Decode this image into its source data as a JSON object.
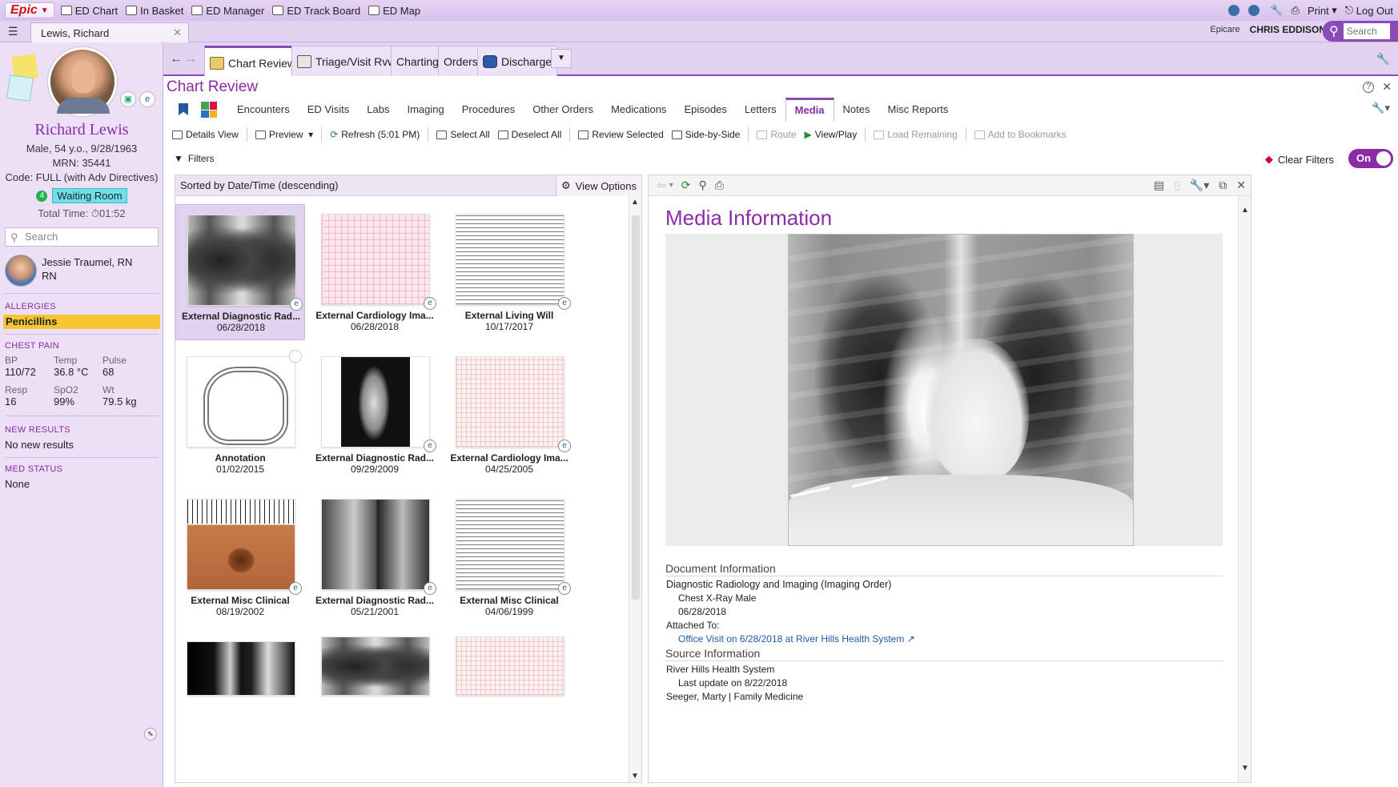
{
  "topbar": {
    "epic_label": "Epic",
    "nav": [
      "ED Chart",
      "In Basket",
      "ED Manager",
      "ED Track Board",
      "ED Map"
    ],
    "print_label": "Print",
    "logout_label": "Log Out"
  },
  "tabbar": {
    "patient_tab": "Lewis, Richard",
    "environment": "Epicare",
    "user": "CHRIS EDDISON",
    "search_placeholder": "Search"
  },
  "activity_tabs": [
    "Chart Review",
    "Triage/Visit Rvw",
    "Charting",
    "Orders",
    "Discharge"
  ],
  "patient": {
    "name": "Richard Lewis",
    "demo": "Male, 54 y.o., 9/28/1963",
    "mrn": "MRN: 35441",
    "code": "Code: FULL (with Adv Directives)",
    "room_num": "4",
    "room": "Waiting Room",
    "total_time": "Total Time: ⏱01:52",
    "search_placeholder": "Search",
    "nurse_name": "Jessie Traumel, RN",
    "nurse_role": "RN"
  },
  "sidebar": {
    "allergies_label": "ALLERGIES",
    "allergy": "Penicillins",
    "complaint_label": "CHEST PAIN",
    "vitals": [
      {
        "label": "BP",
        "value": "110/72"
      },
      {
        "label": "Temp",
        "value": "36.8 °C"
      },
      {
        "label": "Pulse",
        "value": "68"
      },
      {
        "label": "Resp",
        "value": "16"
      },
      {
        "label": "SpO2",
        "value": "99%"
      },
      {
        "label": "Wt",
        "value": "79.5 kg"
      }
    ],
    "results_label": "NEW RESULTS",
    "results_value": "No new results",
    "med_label": "MED STATUS",
    "med_value": "None"
  },
  "chart_review": {
    "title": "Chart Review",
    "subtabs": [
      "Encounters",
      "ED Visits",
      "Labs",
      "Imaging",
      "Procedures",
      "Other Orders",
      "Medications",
      "Episodes",
      "Letters",
      "Media",
      "Notes",
      "Misc Reports"
    ],
    "active_subtab": "Media",
    "toolbar": {
      "details_view": "Details View",
      "preview": "Preview",
      "refresh": "Refresh (5:01 PM)",
      "select_all": "Select All",
      "deselect_all": "Deselect All",
      "review_selected": "Review Selected",
      "side_by_side": "Side-by-Side",
      "route": "Route",
      "view_play": "View/Play",
      "load_remaining": "Load Remaining",
      "add_bookmarks": "Add to Bookmarks"
    },
    "filters_label": "Filters",
    "clear_filters": "Clear Filters",
    "toggle": "On",
    "sort_label": "Sorted by Date/Time (descending)",
    "view_options": "View Options"
  },
  "media_items": [
    {
      "title": "External Diagnostic Rad...",
      "date": "06/28/2018"
    },
    {
      "title": "External Cardiology Ima...",
      "date": "06/28/2018"
    },
    {
      "title": "External Living Will",
      "date": "10/17/2017"
    },
    {
      "title": "Annotation",
      "date": "01/02/2015"
    },
    {
      "title": "External Diagnostic Rad...",
      "date": "09/29/2009"
    },
    {
      "title": "External Cardiology Ima...",
      "date": "04/25/2005"
    },
    {
      "title": "External Misc Clinical",
      "date": "08/19/2002"
    },
    {
      "title": "External Diagnostic Rad...",
      "date": "05/21/2001"
    },
    {
      "title": "External Misc Clinical",
      "date": "04/06/1999"
    }
  ],
  "preview": {
    "heading": "Media Information",
    "doc_info_label": "Document Information",
    "doc_type": "Diagnostic Radiology and Imaging (Imaging Order)",
    "doc_desc": "Chest X-Ray Male",
    "doc_date": "06/28/2018",
    "attached_label": "Attached To:",
    "attached_link": "Office Visit on 6/28/2018 at River Hills Health System ↗",
    "source_label": "Source Information",
    "source_org": "River Hills Health System",
    "last_update": "Last update on 8/22/2018",
    "provider": "Seeger, Marty | Family Medicine"
  }
}
